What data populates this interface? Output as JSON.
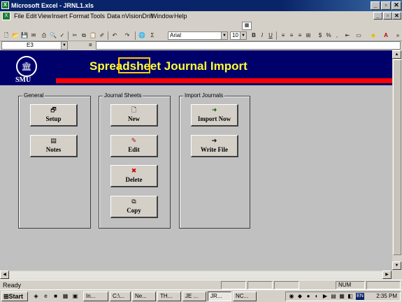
{
  "window": {
    "title": "Microsoft Excel - JRNL1.xls",
    "app_icon": "excel-icon",
    "controls": [
      "_",
      "▫",
      "✕"
    ]
  },
  "menubar": {
    "items": [
      "File",
      "Edit",
      "View",
      "Insert",
      "Format",
      "Tools",
      "Data",
      "nVisionDrill",
      "Window",
      "Help"
    ]
  },
  "toolbar": {
    "font_name": "Arial",
    "font_size": "10"
  },
  "formula_bar": {
    "cell_ref": "E3",
    "fx_symbol": "=",
    "value": ""
  },
  "banner": {
    "logo_text": "SMU",
    "logo_seal_glyph": "🏛",
    "title": "Spreadsheet Journal Import",
    "title_color": "#ffff33",
    "background_color": "#00006b",
    "stripe_color": "#ff0000"
  },
  "groups": {
    "general": {
      "label": "General",
      "buttons": [
        {
          "label": "Setup",
          "icon": "setup-icon",
          "glyph": "🗗"
        },
        {
          "label": "Notes",
          "icon": "notes-icon",
          "glyph": "▤"
        }
      ]
    },
    "journal_sheets": {
      "label": "Journal Sheets",
      "buttons": [
        {
          "label": "New",
          "icon": "new-document-icon",
          "glyph": "🗋"
        },
        {
          "label": "Edit",
          "icon": "edit-pencil-icon",
          "glyph": "✎"
        },
        {
          "label": "Delete",
          "icon": "delete-icon",
          "glyph": "✖"
        },
        {
          "label": "Copy",
          "icon": "copy-icon",
          "glyph": "⧉"
        }
      ]
    },
    "import_journals": {
      "label": "Import Journals",
      "buttons": [
        {
          "label": "Import Now",
          "icon": "import-icon",
          "glyph": "➜"
        },
        {
          "label": "Write File",
          "icon": "write-file-icon",
          "glyph": "➔"
        }
      ]
    }
  },
  "statusbar": {
    "status": "Ready",
    "num_indicator": "NUM"
  },
  "taskbar": {
    "start_label": "Start",
    "tasks": [
      "In...",
      "C:\\...",
      "Ne...",
      "TH...",
      "JE ...",
      "JR...",
      "NC..."
    ],
    "clock": "2:35 PM",
    "lang": "EN"
  }
}
